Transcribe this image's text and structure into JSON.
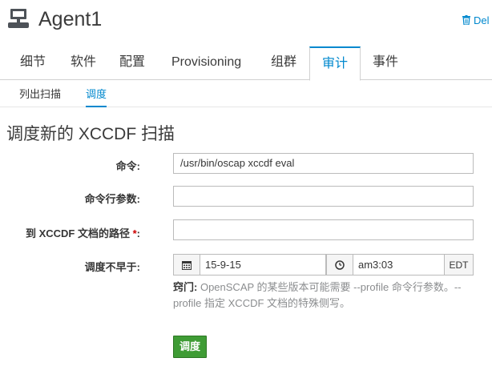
{
  "header": {
    "title": "Agent1",
    "delete_label": "Del",
    "system_icon": "system-icon",
    "delete_icon": "trash-icon"
  },
  "main_tabs": [
    {
      "label": "细节",
      "active": false
    },
    {
      "label": "软件",
      "active": false
    },
    {
      "label": "配置",
      "active": false
    },
    {
      "label": "Provisioning",
      "active": false
    },
    {
      "label": "组群",
      "active": false
    },
    {
      "label": "审计",
      "active": true
    },
    {
      "label": "事件",
      "active": false
    }
  ],
  "sub_tabs": [
    {
      "label": "列出扫描",
      "active": false
    },
    {
      "label": "调度",
      "active": true
    }
  ],
  "form": {
    "title": "调度新的 XCCDF 扫描",
    "command_label": "命令:",
    "command_value": "/usr/bin/oscap xccdf eval",
    "params_label": "命令行参数:",
    "params_value": "",
    "path_label": "到 XCCDF 文档的路径",
    "path_required": "*",
    "path_colon": ":",
    "path_value": "",
    "not_before_label": "调度不早于:",
    "date_value": "15-9-15",
    "time_value": "am3:03",
    "timezone": "EDT",
    "hint_bold": "窍门:",
    "hint_text": " OpenSCAP 的某些版本可能需要 --profile 命令行参数。--profile 指定 XCCDF 文档的特殊侧写。",
    "submit_label": "调度"
  },
  "colors": {
    "accent": "#0088ce",
    "success": "#3f9c35",
    "required": "#cc0000"
  }
}
